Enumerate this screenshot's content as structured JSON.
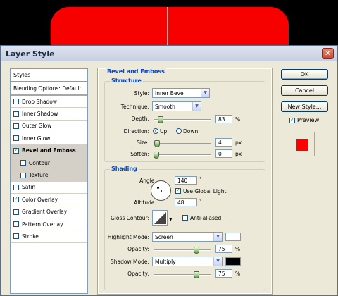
{
  "dialog": {
    "title": "Layer Style"
  },
  "styles_list": {
    "header": "Styles",
    "items": [
      {
        "label": "Blending Options: Default",
        "type": "plain"
      },
      {
        "label": "Drop Shadow",
        "checked": false
      },
      {
        "label": "Inner Shadow",
        "checked": false
      },
      {
        "label": "Outer Glow",
        "checked": false
      },
      {
        "label": "Inner Glow",
        "checked": false
      },
      {
        "label": "Bevel and Emboss",
        "checked": true,
        "selected": true
      },
      {
        "label": "Contour",
        "checked": false,
        "sub": true
      },
      {
        "label": "Texture",
        "checked": false,
        "sub": true
      },
      {
        "label": "Satin",
        "checked": false
      },
      {
        "label": "Color Overlay",
        "checked": true
      },
      {
        "label": "Gradient Overlay",
        "checked": false
      },
      {
        "label": "Pattern Overlay",
        "checked": false
      },
      {
        "label": "Stroke",
        "checked": false
      }
    ]
  },
  "bevel": {
    "title": "Bevel and Emboss",
    "structure": {
      "title": "Structure",
      "style_label": "Style:",
      "style_value": "Inner Bevel",
      "technique_label": "Technique:",
      "technique_value": "Smooth",
      "depth_label": "Depth:",
      "depth_value": "83",
      "depth_unit": "%",
      "depth_level": 0.083,
      "direction_label": "Direction:",
      "dir_up": "Up",
      "dir_down": "Down",
      "direction": "Up",
      "size_label": "Size:",
      "size_value": "4",
      "size_unit": "px",
      "size_level": 0.016,
      "soften_label": "Soften:",
      "soften_value": "0",
      "soften_unit": "px",
      "soften_level": 0
    },
    "shading": {
      "title": "Shading",
      "angle_label": "Angle:",
      "angle_value": "140",
      "angle_unit": "°",
      "global_light_label": "Use Global Light",
      "global_light": true,
      "altitude_label": "Altitude:",
      "altitude_value": "48",
      "altitude_unit": "°",
      "gloss_label": "Gloss Contour:",
      "anti_aliased_label": "Anti-aliased",
      "anti_aliased": false,
      "highlight_label": "Highlight Mode:",
      "highlight_mode": "Screen",
      "highlight_color": "#ffffff",
      "h_opacity_label": "Opacity:",
      "h_opacity_value": "75",
      "h_opacity_unit": "%",
      "h_opacity_level": 0.75,
      "shadow_label": "Shadow Mode:",
      "shadow_mode": "Multiply",
      "shadow_color": "#000000",
      "s_opacity_label": "Opacity:",
      "s_opacity_value": "75",
      "s_opacity_unit": "%",
      "s_opacity_level": 0.75
    }
  },
  "buttons": {
    "ok": "OK",
    "cancel": "Cancel",
    "new_style": "New Style...",
    "preview_label": "Preview",
    "preview": true
  },
  "colors": {
    "preview_fill": "#ff0000",
    "section_title": "#0046d5",
    "canvas_shape": "#f60000"
  }
}
